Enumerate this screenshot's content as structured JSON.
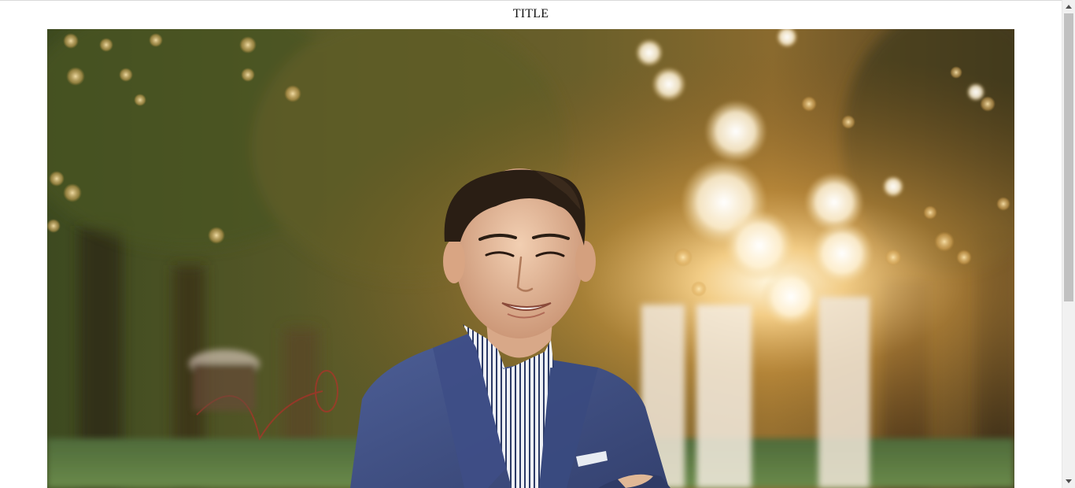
{
  "page": {
    "title": "TITLE"
  },
  "hero": {
    "subject": "portrait-photo"
  },
  "scrollbar": {
    "up_icon": "chevron-up-icon",
    "down_icon": "chevron-down-icon"
  }
}
